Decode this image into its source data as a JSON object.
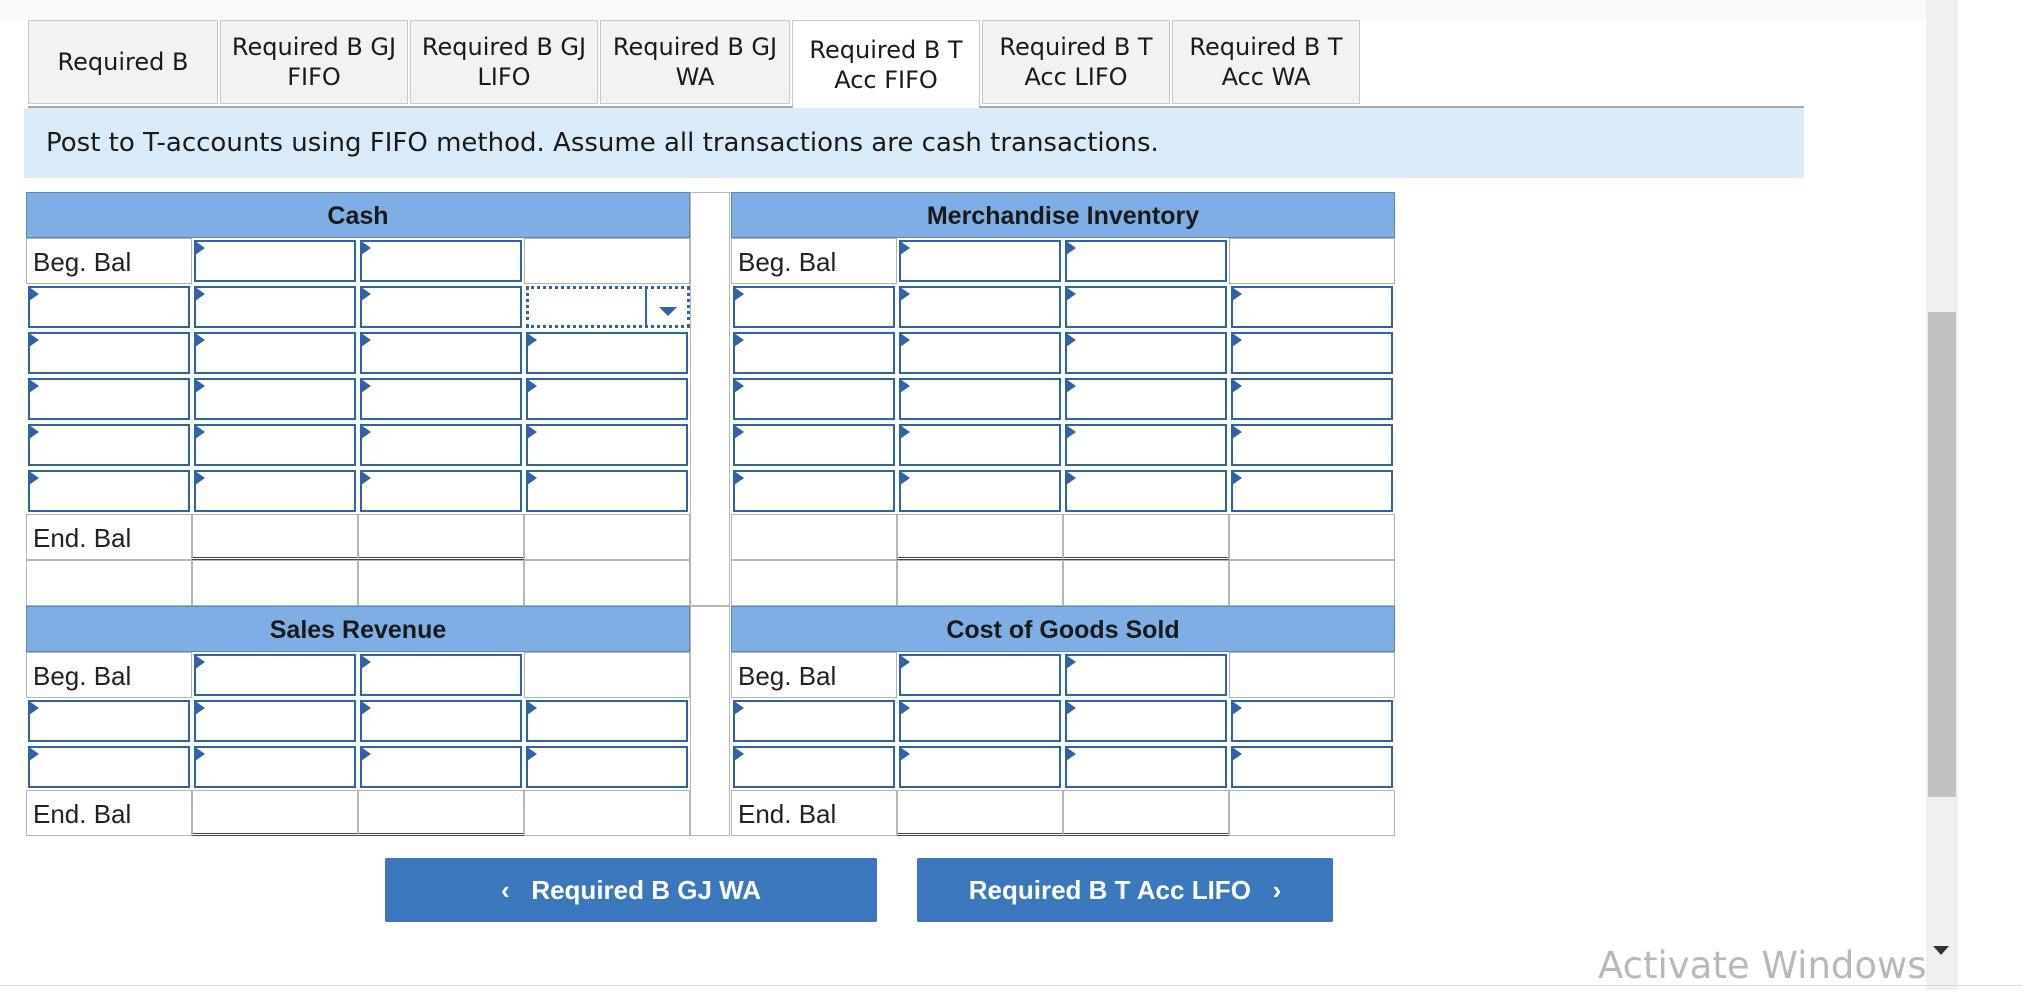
{
  "tabs": [
    {
      "label": "Required B"
    },
    {
      "label": "Required B GJ FIFO"
    },
    {
      "label": "Required B GJ LIFO"
    },
    {
      "label": "Required B GJ WA"
    },
    {
      "label": "Required B T Acc FIFO",
      "active": true
    },
    {
      "label": "Required B T Acc LIFO"
    },
    {
      "label": "Required B T Acc WA"
    }
  ],
  "instruction": "Post to T-accounts using FIFO method. Assume all transactions are cash transactions.",
  "accounts": {
    "cash": {
      "title": "Cash",
      "beg_label": "Beg. Bal",
      "end_label": "End. Bal"
    },
    "inventory": {
      "title": "Merchandise Inventory",
      "beg_label": "Beg. Bal"
    },
    "sales": {
      "title": "Sales Revenue",
      "beg_label": "Beg. Bal",
      "end_label": "End. Bal"
    },
    "cogs": {
      "title": "Cost of Goods Sold",
      "beg_label": "Beg. Bal",
      "end_label": "End. Bal"
    }
  },
  "nav": {
    "prev_label": "Required B GJ WA",
    "next_label": "Required B T Acc LIFO"
  },
  "watermark": "Activate Windows",
  "colors": {
    "header_bg": "#7eaee3",
    "banner_bg": "#d9ebf8",
    "button_bg": "#3a77bd",
    "input_border": "#2f62a7"
  }
}
